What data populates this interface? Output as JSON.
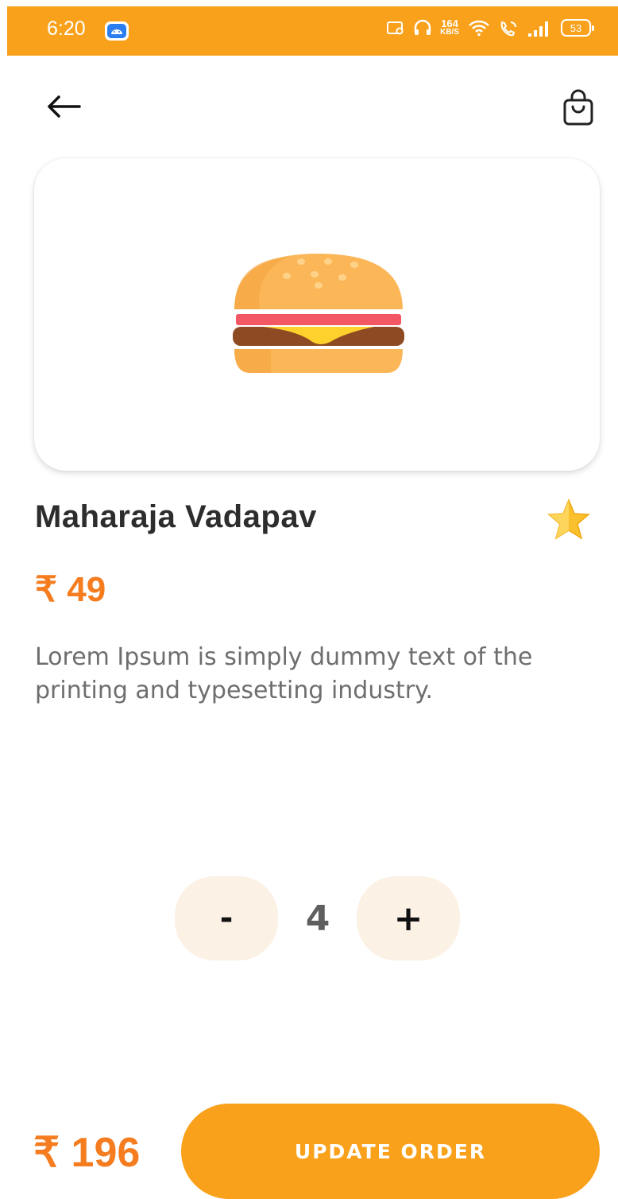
{
  "status_bar": {
    "time": "6:20",
    "network_speed": "164",
    "network_speed_unit": "KB/S",
    "battery": "53",
    "icons": [
      "android-notification-icon",
      "screen-record-icon",
      "headphones-icon",
      "wifi-icon",
      "wifi-calling-icon",
      "signal-icon",
      "battery-icon"
    ]
  },
  "header": {
    "back_icon": "arrow-left-icon",
    "cart_icon": "shopping-bag-icon"
  },
  "product": {
    "image_icon": "burger-icon",
    "name": "Maharaja Vadapav",
    "favorite_icon": "star-icon",
    "unit_price": "₹ 49",
    "description": "Lorem Ipsum is simply dummy text of the printing and typesetting industry."
  },
  "quantity": {
    "decrement_label": "-",
    "value": "4",
    "increment_label": "+"
  },
  "footer": {
    "total_price": "₹ 196",
    "button_label": "UPDATE ORDER"
  },
  "colors": {
    "accent": "#f9a11b",
    "price": "#f57c1f",
    "stepper_bg": "#fbf1e4",
    "title": "#2d2d2d",
    "body_text": "#6e6e6e"
  }
}
